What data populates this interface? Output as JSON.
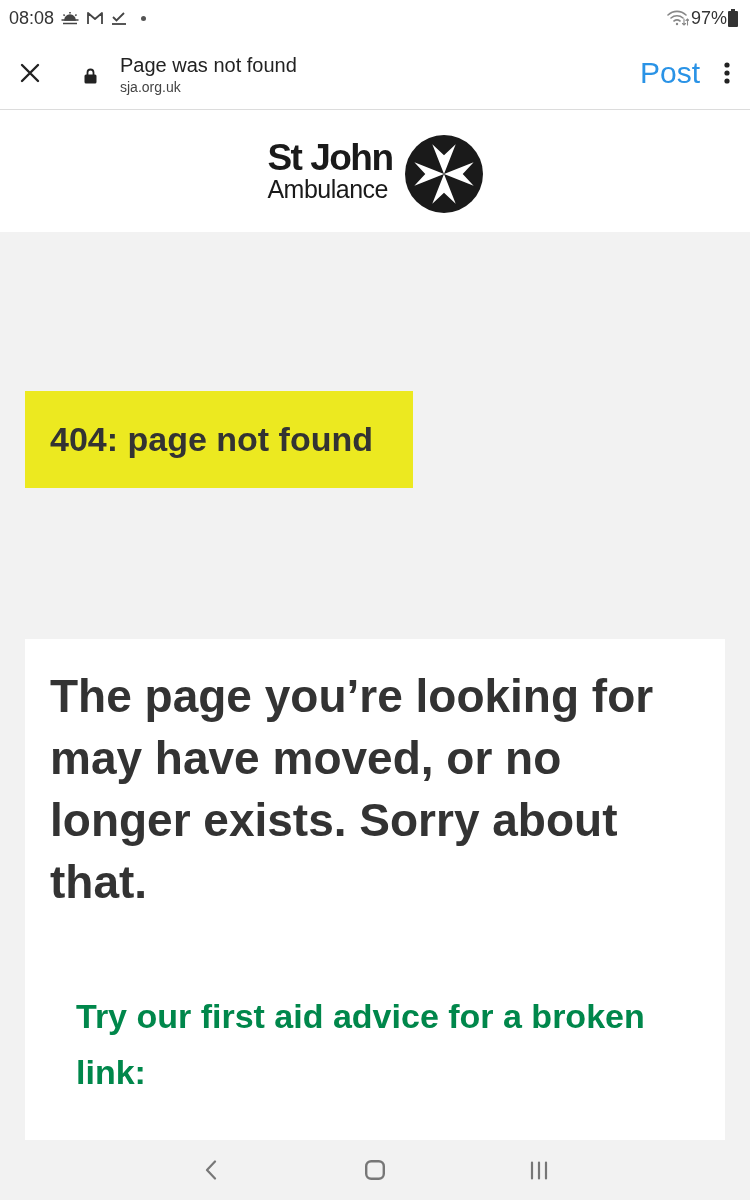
{
  "status_bar": {
    "time": "08:08",
    "battery": "97%"
  },
  "browser_bar": {
    "title": "Page was not found",
    "url": "sja.org.uk",
    "action": "Post"
  },
  "logo": {
    "line_1": "St John",
    "line_2": "Ambulance"
  },
  "error_banner": "404: page not found",
  "message": {
    "heading": "The page you’re looking for may have moved, or no longer exists. Sorry about that.",
    "advice": "Try our first aid advice for a broken link:"
  }
}
